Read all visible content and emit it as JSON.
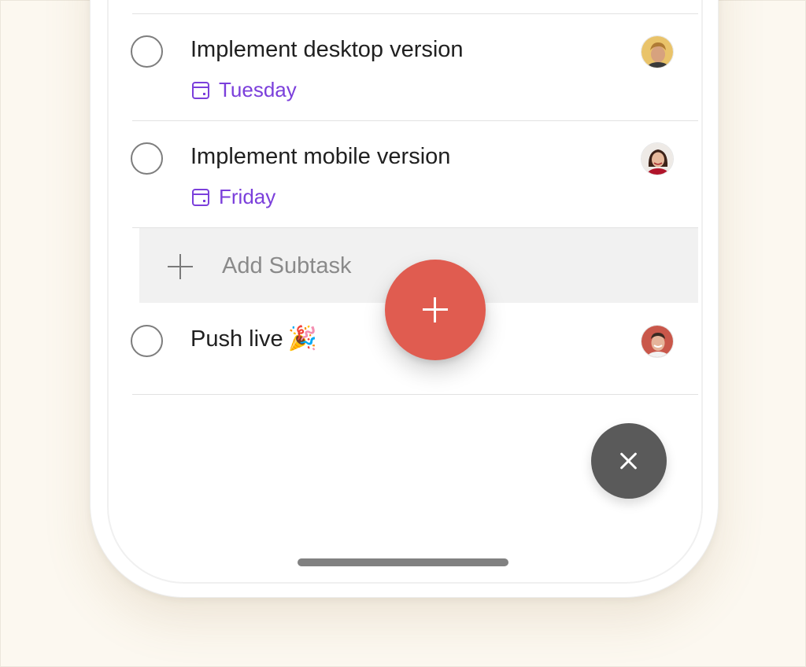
{
  "tasks": [
    {
      "title": "Implement desktop version",
      "due": "Tuesday",
      "avatar_icon": "avatar-man-blond"
    },
    {
      "title": "Implement mobile version",
      "due": "Friday",
      "avatar_icon": "avatar-woman-dark-hair"
    },
    {
      "title": "Push live",
      "emoji": "🎉",
      "avatar_icon": "avatar-man-smiling"
    }
  ],
  "subtask": {
    "placeholder": "Add Subtask"
  },
  "colors": {
    "accent_purple": "#7b3fdb",
    "fab_red": "#e05c50",
    "close_gray": "#5a5a5a",
    "background": "#fcf8f0"
  },
  "icons": {
    "fab": "plus-icon",
    "close": "close-icon",
    "due": "calendar-icon",
    "subtask": "plus-icon"
  }
}
